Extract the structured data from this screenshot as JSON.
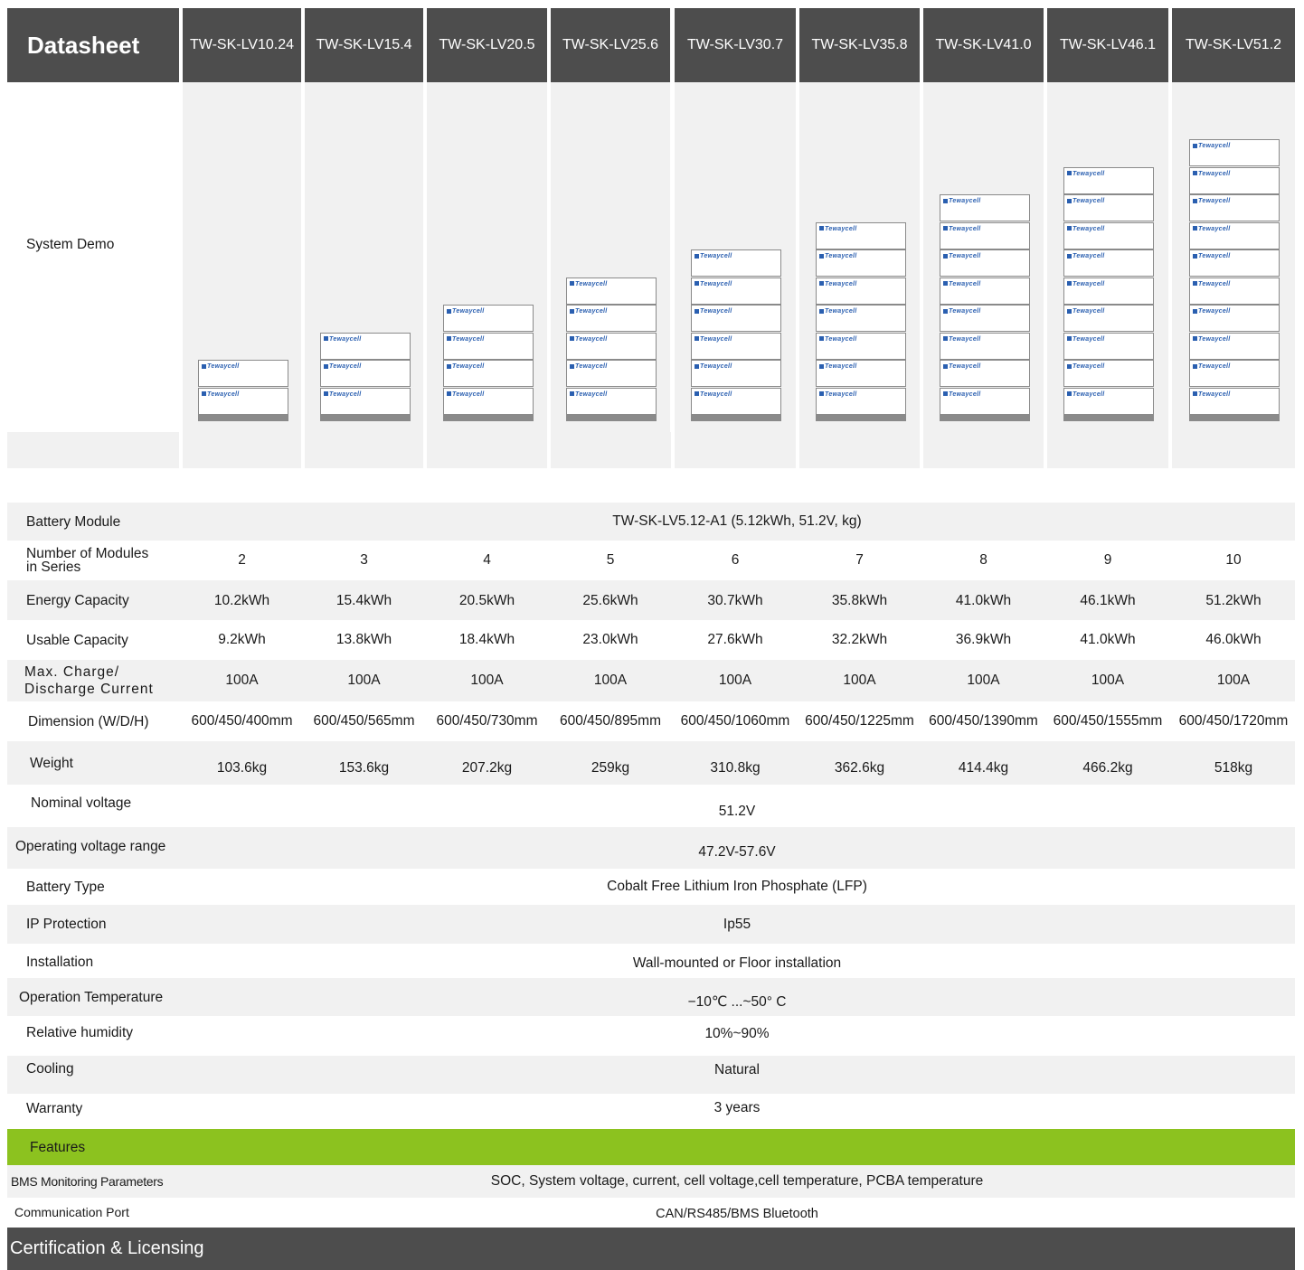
{
  "header": {
    "title": "Datasheet",
    "models": [
      "TW-SK-LV10.24",
      "TW-SK-LV15.4",
      "TW-SK-LV20.5",
      "TW-SK-LV25.6",
      "TW-SK-LV30.7",
      "TW-SK-LV35.8",
      "TW-SK-LV41.0",
      "TW-SK-LV46.1",
      "TW-SK-LV51.2"
    ]
  },
  "system_demo": {
    "label": "System Demo",
    "module_logo": "Tewaycell",
    "module_counts": [
      2,
      3,
      4,
      5,
      6,
      7,
      8,
      9,
      10
    ]
  },
  "specs": {
    "battery_module": {
      "label": "Battery Module",
      "value": "TW-SK-LV5.12-A1 (5.12kWh, 51.2V, kg)"
    },
    "modules_in_series": {
      "label_line1": "Number of Modules",
      "label_line2": "in Series",
      "values": [
        "2",
        "3",
        "4",
        "5",
        "6",
        "7",
        "8",
        "9",
        "10"
      ]
    },
    "energy_capacity": {
      "label": "Energy Capacity",
      "values": [
        "10.2kWh",
        "15.4kWh",
        "20.5kWh",
        "25.6kWh",
        "30.7kWh",
        "35.8kWh",
        "41.0kWh",
        "46.1kWh",
        "51.2kWh"
      ]
    },
    "usable_capacity": {
      "label": "Usable Capacity",
      "values": [
        "9.2kWh",
        "13.8kWh",
        "18.4kWh",
        "23.0kWh",
        "27.6kWh",
        "32.2kWh",
        "36.9kWh",
        "41.0kWh",
        "46.0kWh"
      ]
    },
    "max_current": {
      "label_line1": "Max. Charge/",
      "label_line2": "Discharge Current",
      "values": [
        "100A",
        "100A",
        "100A",
        "100A",
        "100A",
        "100A",
        "100A",
        "100A",
        "100A"
      ]
    },
    "dimension": {
      "label": "Dimension (W/D/H)",
      "values": [
        "600/450/400mm",
        "600/450/565mm",
        "600/450/730mm",
        "600/450/895mm",
        "600/450/1060mm",
        "600/450/1225mm",
        "600/450/1390mm",
        "600/450/1555mm",
        "600/450/1720mm"
      ]
    },
    "weight": {
      "label": "Weight",
      "values": [
        "103.6kg",
        "153.6kg",
        "207.2kg",
        "259kg",
        "310.8kg",
        "362.6kg",
        "414.4kg",
        "466.2kg",
        "518kg"
      ]
    },
    "nominal_voltage": {
      "label": "Nominal voltage",
      "value": "51.2V"
    },
    "operating_voltage": {
      "label": "Operating voltage range",
      "value": "47.2V-57.6V"
    },
    "battery_type": {
      "label": "Battery Type",
      "value": "Cobalt Free Lithium Iron Phosphate (LFP)"
    },
    "ip_protection": {
      "label": "IP Protection",
      "value": "Ip55"
    },
    "installation": {
      "label": "Installation",
      "value": "Wall-mounted or Floor installation"
    },
    "operation_temperature": {
      "label": "Operation Temperature",
      "value": "−10℃ ...~50° C"
    },
    "relative_humidity": {
      "label": "Relative humidity",
      "value": "10%~90%"
    },
    "cooling": {
      "label": "Cooling",
      "value": "Natural"
    },
    "warranty": {
      "label": "Warranty",
      "value": "3 years"
    }
  },
  "features": {
    "title": "Features",
    "bms": {
      "label": "BMS Monitoring Parameters",
      "value": "SOC, System voltage, current, cell voltage,cell temperature, PCBA temperature"
    },
    "comm": {
      "label": "Communication Port",
      "value": "CAN/RS485/BMS Bluetooth"
    }
  },
  "certification": {
    "title": "Certification & Licensing"
  },
  "colors": {
    "header_bg": "#4d4d4d",
    "features_bg": "#8cc21f",
    "logo_blue": "#2a5fb0"
  }
}
